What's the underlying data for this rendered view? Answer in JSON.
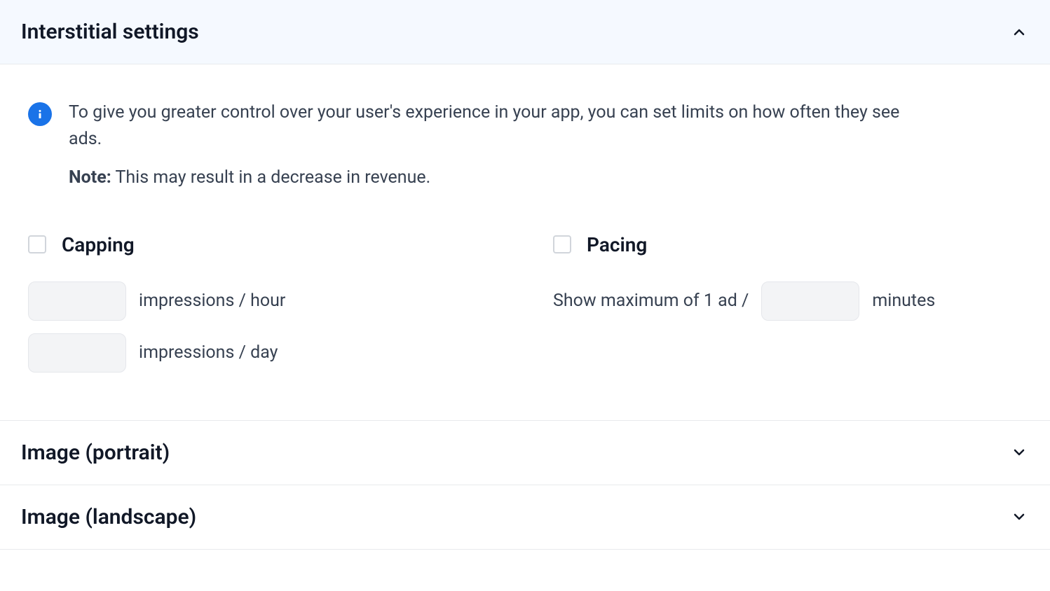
{
  "interstitial": {
    "title": "Interstitial settings",
    "info": {
      "description": "To give you greater control over your user's experience in your app, you can set limits on how often they see ads.",
      "note_label": "Note:",
      "note_text": " This may result in a decrease in revenue."
    },
    "capping": {
      "label": "Capping",
      "impressions_hour_value": "",
      "impressions_hour_label": "impressions / hour",
      "impressions_day_value": "",
      "impressions_day_label": "impressions / day"
    },
    "pacing": {
      "label": "Pacing",
      "prefix_text": "Show maximum of 1 ad /",
      "minutes_value": "",
      "suffix_text": "minutes"
    }
  },
  "sections": {
    "image_portrait": "Image (portrait)",
    "image_landscape": "Image (landscape)"
  }
}
